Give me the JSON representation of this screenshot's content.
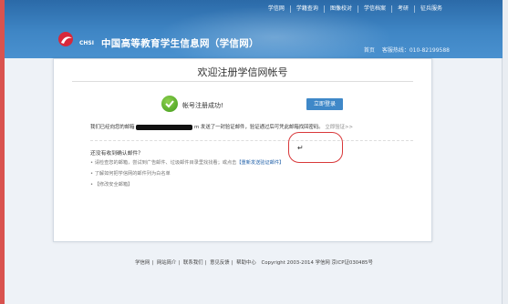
{
  "header": {
    "top_nav": [
      "学信网",
      "学籍查询",
      "图像校对",
      "学信档案",
      "考研",
      "征兵服务"
    ],
    "logo_text": "CHSI",
    "site_title": "中国高等教育学生信息网（学信网）",
    "home_link": "首页",
    "hotline": "客服热线：010-82199588"
  },
  "card": {
    "title": "欢迎注册学信网帐号",
    "success_text": "帐号注册成功!",
    "login_button": "立即登录",
    "message_prefix": "我们已经向您的邮箱",
    "message_suffix": "m 发送了一封验证邮件，验证通过后可凭此邮箱找回密码。",
    "verify_link": "立即验证>>",
    "help_title": "还没有收到确认邮件？",
    "help_1_prefix": "• 请检查您的邮箱，尝试到广告邮件、垃圾邮件目录里找找看；或点击",
    "help_1_link": "【重新发送验证邮件】",
    "help_2": "• 了解如何把学信网的邮件列为白名单",
    "help_3": "• 【修改安全邮箱】"
  },
  "annotation": {
    "enter_symbol": "↵"
  },
  "footer": {
    "links": [
      "学信网",
      "网站简介",
      "联系我们",
      "意见反馈",
      "帮助中心"
    ],
    "copyright": "Copyright 2003-2014 学信网 京ICP证030485号"
  },
  "colors": {
    "header_blue": "#3f86c5",
    "button_blue": "#3f88c8",
    "callout_red": "#d9383a",
    "success_green": "#3f9b1a"
  }
}
